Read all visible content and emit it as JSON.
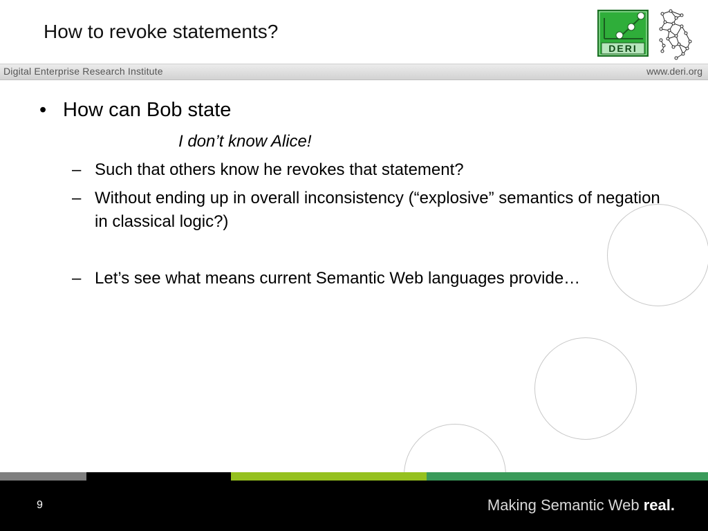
{
  "slide": {
    "title": "How to revoke statements?",
    "header": {
      "institute": "Digital Enterprise Research Institute",
      "url": "www.deri.org"
    },
    "bullet": "How can Bob state",
    "quote": "I don’t know Alice!",
    "sub_items": [
      "Such that others know he revokes that statement?",
      "Without ending up in overall inconsistency (“explosive” semantics of negation in classical logic?)",
      "Let’s see what means current Semantic Web languages provide…"
    ],
    "bullet_marker": "•",
    "dash_marker": "–",
    "logo_text": "DERI",
    "page_number": "9",
    "tagline": {
      "normal": "Making Semantic Web ",
      "bold": "real."
    }
  },
  "colors": {
    "logo_green": "#2fae3a",
    "strip_gray": "#7f7f7f",
    "strip_lime": "#95c11f",
    "strip_green": "#3a9a5a",
    "footer": "#000000"
  },
  "icons": [
    "deri-logo-icon",
    "map-network-icon"
  ]
}
